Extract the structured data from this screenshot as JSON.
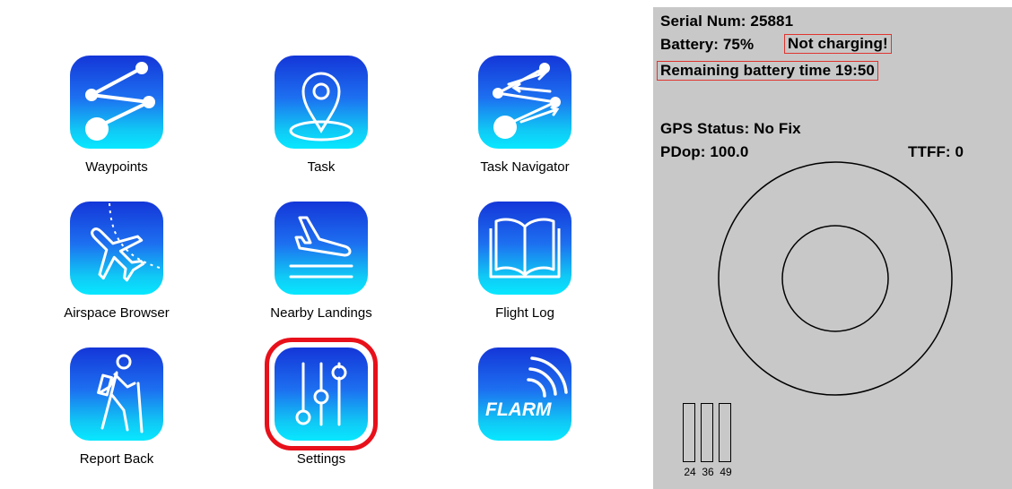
{
  "menu": {
    "apps": [
      {
        "label": "Waypoints",
        "icon": "waypoints-icon"
      },
      {
        "label": "Task",
        "icon": "map-pin-icon"
      },
      {
        "label": "Task Navigator",
        "icon": "task-navigator-icon"
      },
      {
        "label": "Airspace Browser",
        "icon": "airplane-icon"
      },
      {
        "label": "Nearby Landings",
        "icon": "landing-icon"
      },
      {
        "label": "Flight Log",
        "icon": "open-book-icon"
      },
      {
        "label": "Report Back",
        "icon": "hiker-icon"
      },
      {
        "label": "Settings",
        "icon": "sliders-icon"
      },
      {
        "label": "",
        "icon": "flarm-icon",
        "logo_text": "FLARM"
      }
    ],
    "selected": "Settings",
    "colors": {
      "tile_top": "#1436d8",
      "tile_bottom": "#08e8ff",
      "selection": "#e8101a"
    }
  },
  "status": {
    "serial": "Serial Num: 25881",
    "battery_label": "Battery:  75%",
    "charging": "Not charging!",
    "remaining": "Remaining battery time 19:50",
    "gps_status": "GPS Status:  No Fix",
    "pdop": "PDop: 100.0",
    "ttff": "TTFF: 0",
    "satellites": [
      "24",
      "36",
      "49"
    ],
    "colors": {
      "panel_bg": "#c8c8c8",
      "highlight_box": "#e0342f"
    }
  }
}
